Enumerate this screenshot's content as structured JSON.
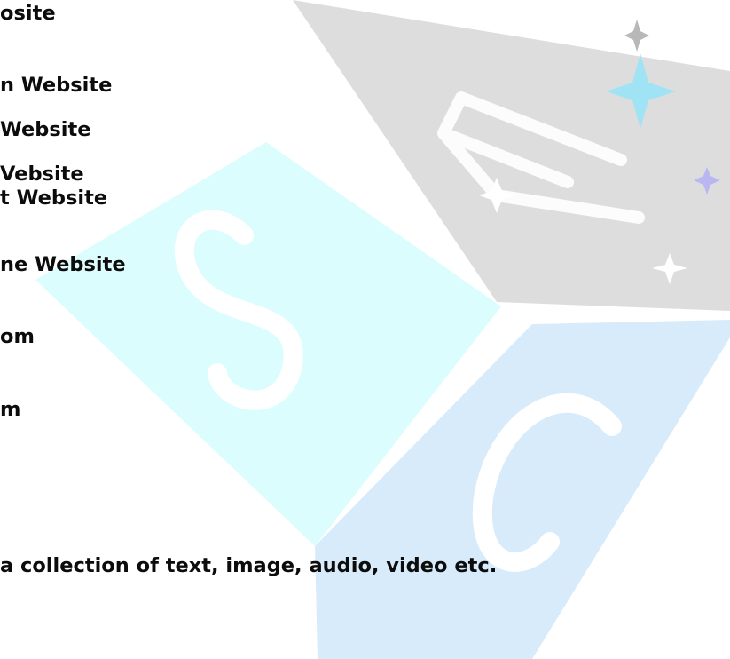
{
  "watermark": {
    "logo_letters": [
      "E",
      "S",
      "C"
    ],
    "colors": {
      "cyan_face": "#dcfdfd",
      "gray_face": "#d9d9d9",
      "blue_face": "#d8ebfa",
      "sparkle_cyan": "#9fe3f5",
      "sparkle_gray": "#b8b8b8",
      "sparkle_violet": "#b9b6f2"
    }
  },
  "document": {
    "lines": [
      "osite",
      "n Website",
      "Website",
      "Vebsite",
      "t Website",
      "ne Website",
      "om",
      "m",
      "a collection of text, image, audio, video etc."
    ]
  }
}
